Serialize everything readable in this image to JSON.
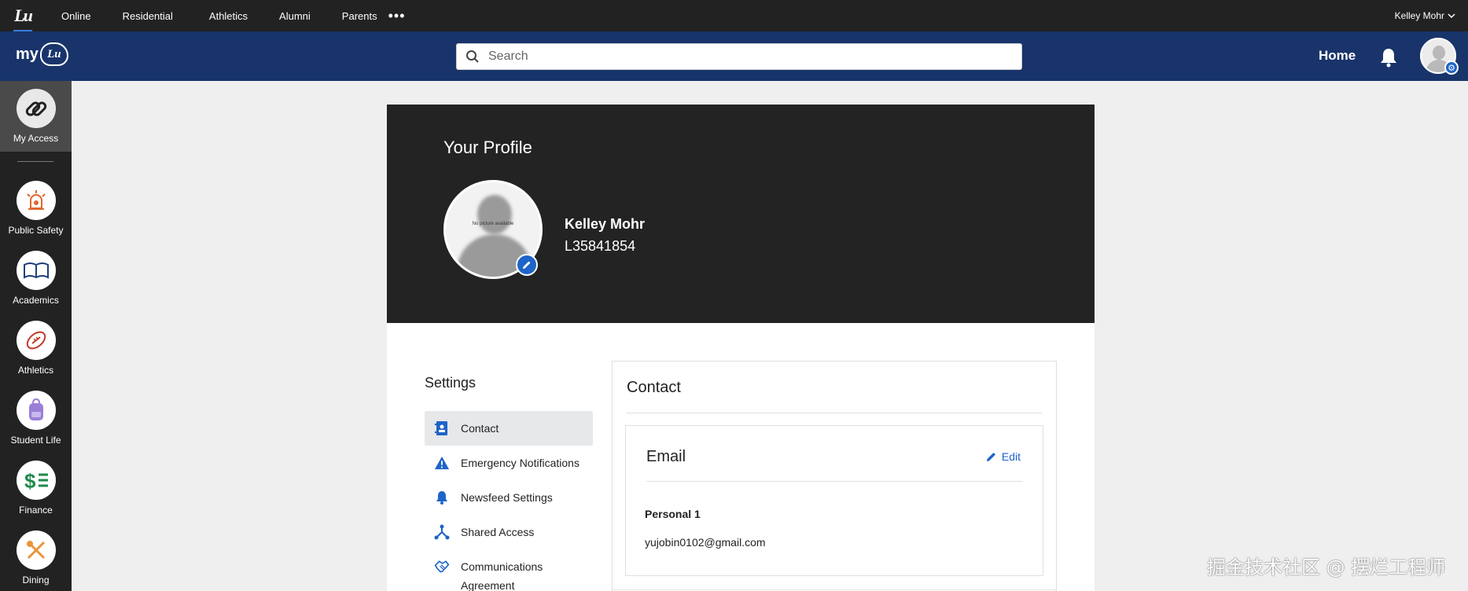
{
  "topbar": {
    "logo_text": "Lu",
    "links": [
      "Online",
      "Residential",
      "Athletics",
      "Alumni",
      "Parents"
    ],
    "more": "•••",
    "user_name": "Kelley Mohr",
    "user_caret": "⌄"
  },
  "header": {
    "brand_my": "my",
    "brand_lu": "Lu",
    "search_placeholder": "Search",
    "home_label": "Home",
    "gear_glyph": "⚙"
  },
  "rail": {
    "items": [
      {
        "label": "My Access",
        "icon": "link-icon"
      },
      {
        "label": "Public Safety",
        "icon": "siren-icon"
      },
      {
        "label": "Academics",
        "icon": "book-icon"
      },
      {
        "label": "Athletics",
        "icon": "football-icon"
      },
      {
        "label": "Student Life",
        "icon": "backpack-icon"
      },
      {
        "label": "Finance",
        "icon": "finance-icon"
      },
      {
        "label": "Dining",
        "icon": "utensils-icon"
      }
    ]
  },
  "profile": {
    "title": "Your Profile",
    "no_picture_text": "No picture available",
    "name": "Kelley Mohr",
    "id": "L35841854"
  },
  "settings": {
    "title": "Settings",
    "items": [
      {
        "label": "Contact",
        "icon": "contact-card-icon"
      },
      {
        "label": "Emergency Notifications",
        "icon": "warning-icon"
      },
      {
        "label": "Newsfeed Settings",
        "icon": "bell-icon"
      },
      {
        "label": "Shared Access",
        "icon": "share-icon"
      },
      {
        "label": "Communications Agreement",
        "icon": "handshake-icon"
      }
    ]
  },
  "contact": {
    "title": "Contact",
    "email": {
      "title": "Email",
      "edit_label": "Edit",
      "entry_label": "Personal 1",
      "entry_value": "yujobin0102@gmail.com"
    }
  },
  "watermark": "掘金技术社区 @ 摆烂工程师",
  "colors": {
    "topbar_bg": "#222222",
    "header_bg": "#18346b",
    "accent_blue": "#1e64c8",
    "hero_bg": "#232323",
    "active_menu_bg": "#e6e8ea"
  }
}
